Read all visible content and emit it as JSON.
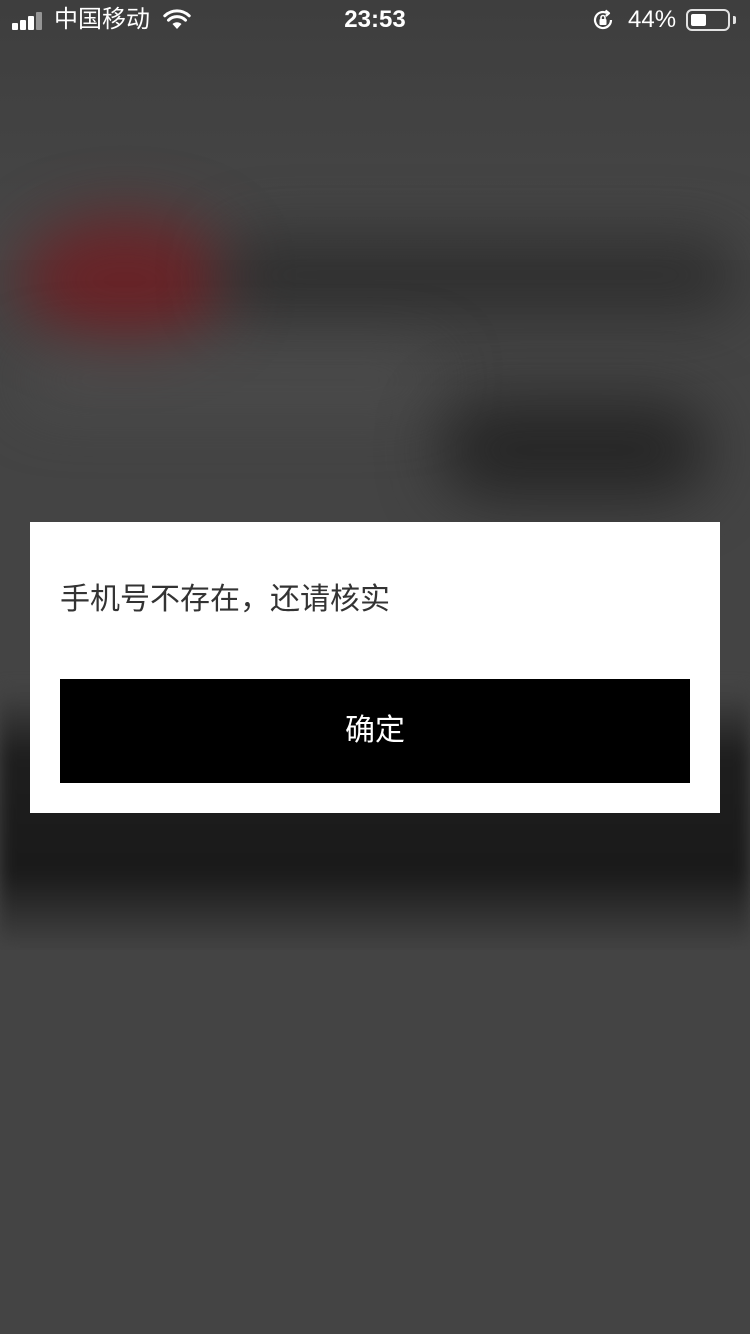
{
  "status_bar": {
    "carrier": "中国移动",
    "time": "23:53",
    "battery_percent_label": "44%",
    "battery_level": 0.44,
    "icons": [
      "signal-icon",
      "wifi-icon",
      "rotation-lock-icon",
      "battery-icon"
    ]
  },
  "dialog": {
    "message": "手机号不存在，还请核实",
    "confirm_label": "确定"
  },
  "colors": {
    "overlay_background": "#444444",
    "dialog_background": "#ffffff",
    "button_background": "#000000",
    "button_text": "#ffffff",
    "message_text": "#333333"
  }
}
